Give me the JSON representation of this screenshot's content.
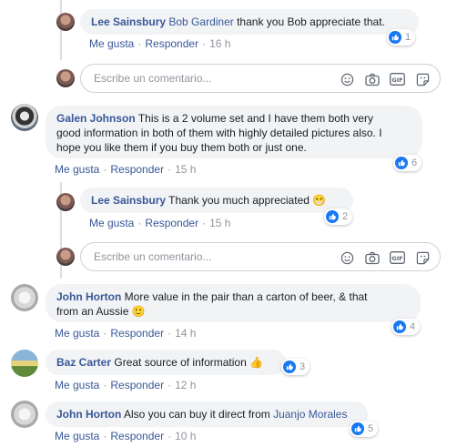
{
  "comments": [
    {
      "author": "Lee Sainsbury",
      "mention": "Bob Gardiner",
      "text": "thank you Bob appreciate that.",
      "like": "Me gusta",
      "reply": "Responder",
      "time": "16 h",
      "reactions": "1"
    },
    {
      "author": "Galen Johnson",
      "text_line1": "This is a 2 volume set and I have them both very",
      "text_line2": "good information in both of them with highly detailed pictures also. I",
      "text_line3": "hope you like them if you buy them both or just one.",
      "like": "Me gusta",
      "reply": "Responder",
      "time": "15 h",
      "reactions": "6"
    },
    {
      "author": "Lee Sainsbury",
      "text": "Thank you much appreciated",
      "emoji": "😁",
      "like": "Me gusta",
      "reply": "Responder",
      "time": "15 h",
      "reactions": "2"
    },
    {
      "author": "John Horton",
      "text_line1": "More value in the pair than a carton of beer, & that",
      "text_line2": "from an Aussie",
      "emoji": "🙂",
      "like": "Me gusta",
      "reply": "Responder",
      "time": "14 h",
      "reactions": "4"
    },
    {
      "author": "Baz Carter",
      "text": "Great source of information",
      "emoji": "👍",
      "like": "Me gusta",
      "reply": "Responder",
      "time": "12 h",
      "reactions": "3"
    },
    {
      "author": "John Horton",
      "text": "Also you can buy it direct from",
      "mention": "Juanjo Morales",
      "like": "Me gusta",
      "reply": "Responder",
      "time": "10 h",
      "reactions": "5"
    }
  ],
  "composer": {
    "placeholder": "Escribe un comentario..."
  },
  "separator": "·",
  "colors": {
    "link": "#385898",
    "bubble": "#f2f3f5",
    "like_blue": "#1877f2",
    "meta": "#90949c"
  },
  "icons": [
    "smiley-icon",
    "camera-icon",
    "gif-icon",
    "sticker-icon",
    "like-icon"
  ]
}
